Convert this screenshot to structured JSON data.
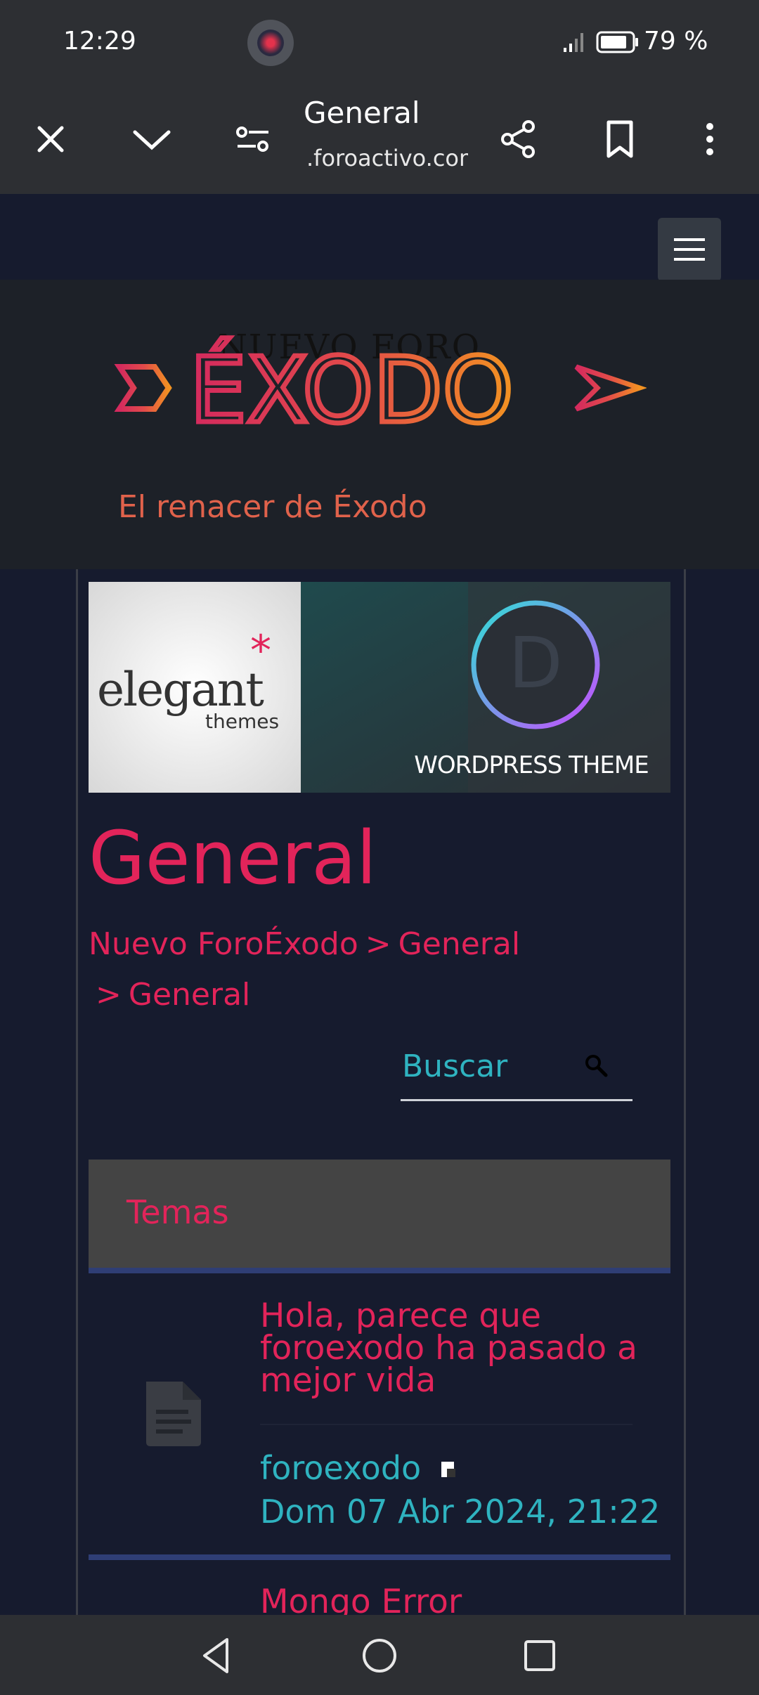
{
  "status_bar": {
    "time": "12:29",
    "battery": "79 %"
  },
  "browser": {
    "title": "General",
    "url": ".foroactivo.com",
    "icons": [
      "close-icon",
      "chevron-down-icon",
      "page-settings-icon",
      "share-icon",
      "bookmark-icon",
      "more-vert-icon"
    ]
  },
  "site": {
    "logo_text": "NUEVO FORO ÉXODO",
    "tagline": "El renacer de Éxodo",
    "banner": {
      "left_text": "elegant",
      "left_sub": "themes",
      "right_text": "WORDPRESS THEME",
      "right_letter": "D"
    },
    "page_title": "General",
    "breadcrumbs": [
      "Nuevo ForoÉxodo",
      "General",
      "General"
    ],
    "search_placeholder": "Buscar"
  },
  "topics_header": "Temas",
  "topics": [
    {
      "title": "Hola, parece que foroexodo ha pasado a mejor vida",
      "author": "foroexodo",
      "date": "Dom 07 Abr 2024, 21:22"
    },
    {
      "title": "Mongo Error"
    }
  ],
  "colors": {
    "accent": "#e2245a",
    "link": "#2fb3c0",
    "background": "#161b2e",
    "tagline": "#e0624b"
  }
}
